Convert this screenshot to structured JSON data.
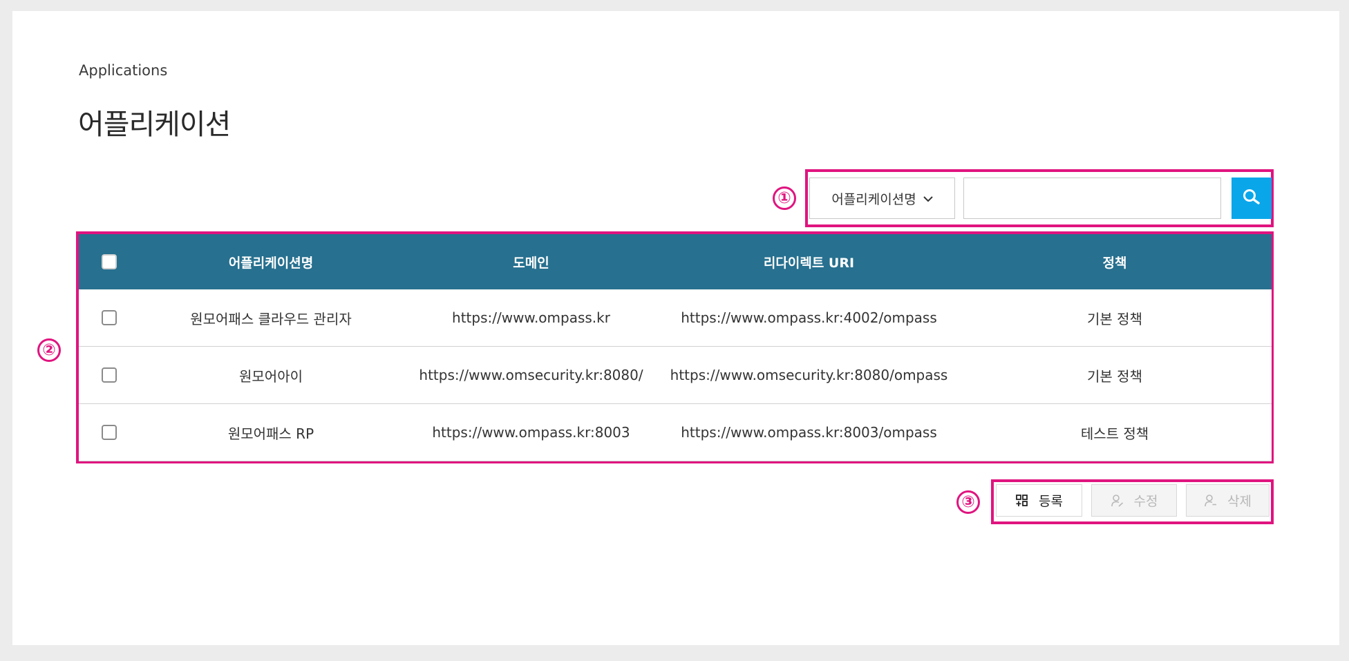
{
  "page": {
    "breadcrumb": "Applications",
    "title": "어플리케이션"
  },
  "markers": {
    "search": "①",
    "table": "②",
    "actions": "③"
  },
  "search": {
    "select_value": "어플리케이션명",
    "input_value": "",
    "input_placeholder": ""
  },
  "table": {
    "columns": [
      "어플리케이션명",
      "도메인",
      "리다이렉트 URI",
      "정책"
    ],
    "rows": [
      {
        "name": "원모어패스 클라우드 관리자",
        "domain": "https://www.ompass.kr",
        "redirect_uri": "https://www.ompass.kr:4002/ompass",
        "policy": "기본 정책"
      },
      {
        "name": "원모어아이",
        "domain": "https://www.omsecurity.kr:8080/",
        "redirect_uri": "https://www.omsecurity.kr:8080/ompass",
        "policy": "기본 정책"
      },
      {
        "name": "원모어패스 RP",
        "domain": "https://www.ompass.kr:8003",
        "redirect_uri": "https://www.ompass.kr:8003/ompass",
        "policy": "테스트 정책"
      }
    ]
  },
  "actions": {
    "register_label": "등록",
    "edit_label": "수정",
    "delete_label": "삭제"
  },
  "colors": {
    "header_bg": "#27708f",
    "search_button": "#0aa6ea",
    "highlight": "#e0147f"
  },
  "icons": {
    "search_button": "search-icon",
    "register": "grid-add-icon",
    "edit": "user-edit-icon",
    "delete": "user-delete-icon",
    "select": "chevron-down-icon"
  }
}
